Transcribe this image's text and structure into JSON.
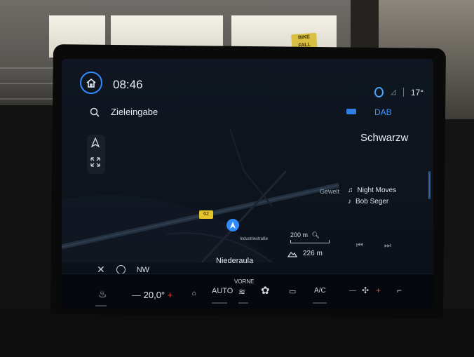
{
  "status": {
    "time": "08:46",
    "temperature": "17°"
  },
  "search": {
    "label": "Zieleingabe"
  },
  "map": {
    "road_shield": "62",
    "street_name": "Industriestraße",
    "place_partial": "Gewelt",
    "scale": "200 m",
    "elevation": "226 m",
    "location_name": "Niederaula",
    "heading": "NW"
  },
  "media": {
    "source": "DAB",
    "station": "Schwarzw",
    "track": "Night Moves",
    "artist": "Bob Seger"
  },
  "climate": {
    "driver_temp": "20,0°",
    "auto_label": "AUTO",
    "front_label": "VORNE",
    "ac_label": "A/C"
  },
  "background_sign": "BIKE FALL",
  "colors": {
    "accent": "#2f8bff",
    "plus": "#e04848"
  }
}
